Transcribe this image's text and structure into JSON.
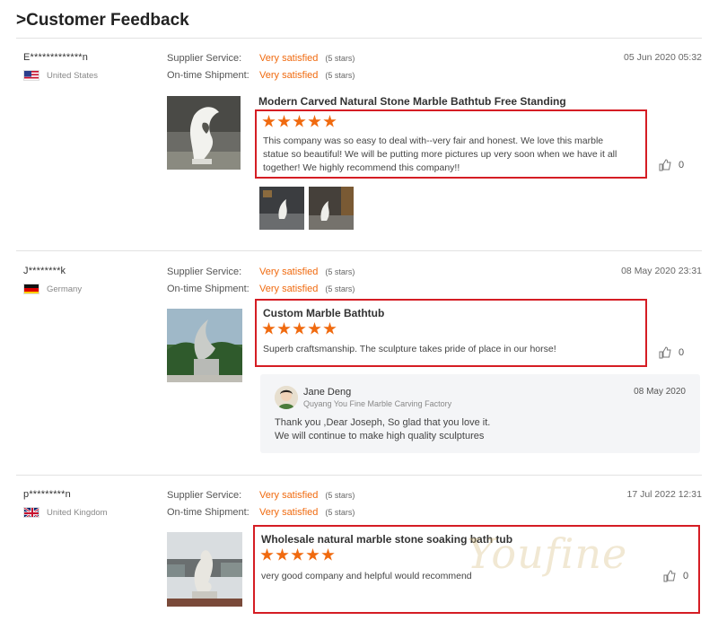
{
  "page": {
    "title": ">Customer Feedback"
  },
  "labels": {
    "supplier_service": "Supplier Service:",
    "ontime_shipment": "On-time Shipment:",
    "very_satisfied": "Very satisfied",
    "five_stars": "(5 stars)"
  },
  "colors": {
    "accent": "#f06a0f",
    "highlight_border": "#d51d24",
    "reply_bg": "#f4f5f7"
  },
  "reviews": [
    {
      "customer": "E*************n",
      "country": "United States",
      "flag_icon": "flag-us-icon",
      "date": "05 Jun 2020 05:32",
      "supplier_service_stars": 5,
      "shipment_stars": 5,
      "product_title": "Modern Carved Natural Stone Marble Bathtub Free Standing",
      "rating": 5,
      "text": [
        "This company was so easy to deal with--very fair and honest.  We love this marble",
        "statue so beautiful!  We will be putting more pictures up very soon when we have it all",
        "together!  We highly recommend this company!!"
      ],
      "likes": "0"
    },
    {
      "customer": "J********k",
      "country": "Germany",
      "flag_icon": "flag-de-icon",
      "date": "08 May 2020 23:31",
      "supplier_service_stars": 5,
      "shipment_stars": 5,
      "product_title": "Custom Marble Bathtub",
      "rating": 5,
      "text": [
        "Superb craftsmanship. The sculpture takes pride of place in our horse!"
      ],
      "likes": "0",
      "reply": {
        "name": "Jane Deng",
        "company": "Quyang You Fine Marble Carving Factory",
        "date": "08 May 2020",
        "text": [
          "Thank you ,Dear Joseph, So glad that you love it.",
          "We will continue to make high quality sculptures"
        ]
      }
    },
    {
      "customer": "p*********n",
      "country": "United Kingdom",
      "flag_icon": "flag-uk-icon",
      "date": "17 Jul 2022 12:31",
      "supplier_service_stars": 5,
      "shipment_stars": 5,
      "product_title": "Wholesale natural marble stone soaking bath tub",
      "rating": 5,
      "text": [
        "very good company and helpful would recommend"
      ],
      "likes": "0"
    }
  ],
  "watermark": "Youfine"
}
